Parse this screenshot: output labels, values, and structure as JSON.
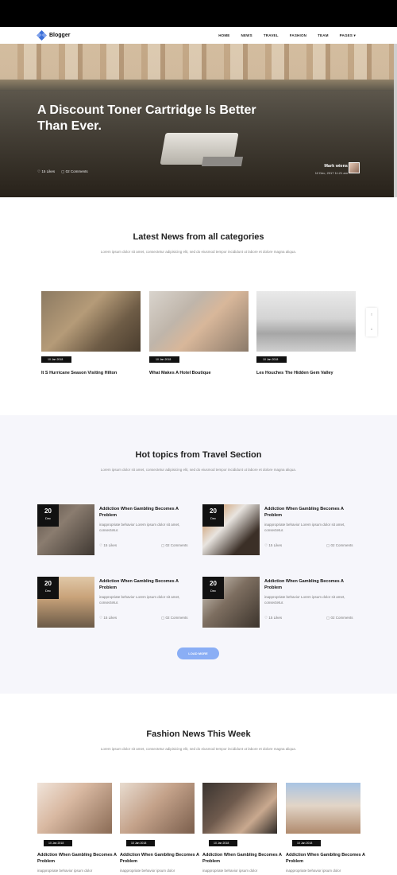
{
  "nav": {
    "logo_text": "Blogger",
    "menu": [
      "HOME",
      "NEWS",
      "TRAVEL",
      "FASHION",
      "TEAM",
      "PAGES"
    ]
  },
  "hero": {
    "title": "A Discount Toner Cartridge Is Better Than Ever.",
    "likes": "15 Likes",
    "comments": "02 Comments",
    "author": "Mark wiens",
    "date": "12 Dec, 2017 11:21 am"
  },
  "latest": {
    "title": "Latest News from all categories",
    "desc": "Lorem ipsum dolor sit amet, consectetur adipisicing elit, sed do eiusmod tempor incididunt ut labore et dolore magna aliqua.",
    "cards": [
      {
        "date": "10 Jan 2018",
        "title": "It S Hurricane Season Visiting Hilton"
      },
      {
        "date": "10 Jan 2018",
        "title": "What Makes A Hotel Boutique"
      },
      {
        "date": "10 Jan 2018",
        "title": "Les Houches The Hidden Gem Valley"
      }
    ]
  },
  "hot": {
    "title": "Hot topics from Travel Section",
    "desc": "Lorem ipsum dolor sit amet, consectetur adipisicing elit, sed do eiusmod tempor incididunt ut labore et dolore magna aliqua.",
    "cards": [
      {
        "day": "20",
        "month": "Dec",
        "title": "Addiction When Gambling Becomes A Problem",
        "text": "inappropriate behavior Lorem ipsum dolor sit amet, consectetur.",
        "likes": "15 Likes",
        "comments": "02 Comments"
      },
      {
        "day": "20",
        "month": "Dec",
        "title": "Addiction When Gambling Becomes A Problem",
        "text": "inappropriate behavior Lorem ipsum dolor sit amet, consectetur.",
        "likes": "15 Likes",
        "comments": "02 Comments"
      },
      {
        "day": "20",
        "month": "Dec",
        "title": "Addiction When Gambling Becomes A Problem",
        "text": "inappropriate behavior Lorem ipsum dolor sit amet, consectetur.",
        "likes": "15 Likes",
        "comments": "02 Comments"
      },
      {
        "day": "20",
        "month": "Dec",
        "title": "Addiction When Gambling Becomes A Problem",
        "text": "inappropriate behavior Lorem ipsum dolor sit amet, consectetur.",
        "likes": "15 Likes",
        "comments": "02 Comments"
      }
    ],
    "load_more": "LOAD MORE"
  },
  "fashion": {
    "title": "Fashion News This Week",
    "desc": "Lorem ipsum dolor sit amet, consectetur adipisicing elit, sed do eiusmod tempor incididunt ut labore et dolore magna aliqua.",
    "cards": [
      {
        "date": "10 Jan 2018",
        "title": "Addiction When Gambling Becomes A Problem",
        "text": "inappropriate behavior ipsum dolor"
      },
      {
        "date": "10 Jan 2018",
        "title": "Addiction When Gambling Becomes A Problem",
        "text": "inappropriate behavior ipsum dolor"
      },
      {
        "date": "10 Jan 2018",
        "title": "Addiction When Gambling Becomes A Problem",
        "text": "inappropriate behavior ipsum dolor"
      },
      {
        "date": "10 Jan 2018",
        "title": "Addiction When Gambling Becomes A Problem",
        "text": "inappropriate behavior ipsum dolor"
      }
    ]
  },
  "icons": {
    "like": "heart-icon",
    "comment": "chat-bubble-icon",
    "logo": "diamond-logo-icon",
    "up": "arrow-up-icon",
    "down": "arrow-down-icon"
  },
  "colors": {
    "accent": "#8aaef5",
    "dark": "#111111",
    "logo_blue": "#3b6fd8"
  }
}
